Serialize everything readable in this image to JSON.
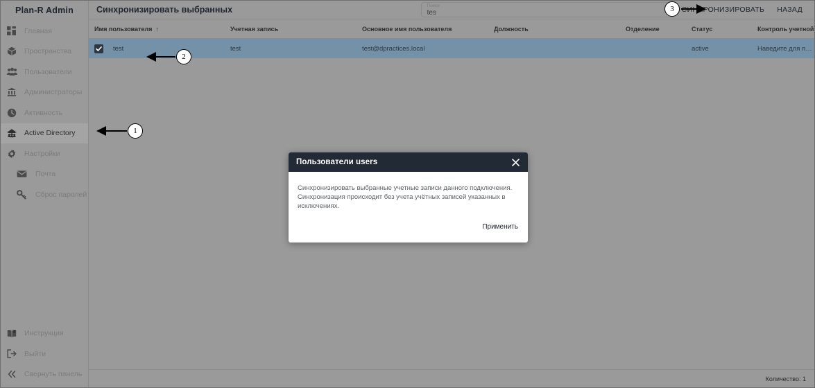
{
  "app": {
    "brand": "Plan-R Admin"
  },
  "sidebar": {
    "items": [
      {
        "label": "Главная",
        "icon": "dashboard-icon",
        "active": false,
        "indent": false
      },
      {
        "label": "Пространства",
        "icon": "cube-icon",
        "active": false,
        "indent": false
      },
      {
        "label": "Пользователи",
        "icon": "users-group-icon",
        "active": false,
        "indent": false
      },
      {
        "label": "Администраторы",
        "icon": "bank-icon",
        "active": false,
        "indent": false
      },
      {
        "label": "Активность",
        "icon": "clock-icon",
        "active": false,
        "indent": false
      },
      {
        "label": "Active Directory",
        "icon": "active-directory-icon",
        "active": true,
        "indent": false
      },
      {
        "label": "Настройки",
        "icon": "gear-icon",
        "active": false,
        "indent": false
      },
      {
        "label": "Почта",
        "icon": "mail-icon",
        "active": false,
        "indent": true
      },
      {
        "label": "Сброс паролей",
        "icon": "key-icon",
        "active": false,
        "indent": true
      }
    ],
    "bottom_items": [
      {
        "label": "Инструкция",
        "icon": "book-icon"
      },
      {
        "label": "Выйти",
        "icon": "logout-icon"
      },
      {
        "label": "Свернуть панель",
        "icon": "chevrons-left-icon"
      }
    ]
  },
  "header": {
    "title": "Синхронизировать выбранных",
    "search": {
      "label": "Поиск",
      "value": "tes",
      "placeholder": "Поиск"
    },
    "sync_button": "СИНХРОНИЗИРОВАТЬ",
    "back_button": "НАЗАД"
  },
  "table": {
    "columns": [
      {
        "key": "name",
        "label": "Имя пользователя",
        "sorted": true,
        "sort_arrow": "↑"
      },
      {
        "key": "acct",
        "label": "Учетная запись",
        "sorted": false,
        "sort_arrow": ""
      },
      {
        "key": "upn",
        "label": "Основное имя пользователя",
        "sorted": false,
        "sort_arrow": ""
      },
      {
        "key": "pos",
        "label": "Должность",
        "sorted": false,
        "sort_arrow": ""
      },
      {
        "key": "dept",
        "label": "Отделение",
        "sorted": false,
        "sort_arrow": ""
      },
      {
        "key": "status",
        "label": "Статус",
        "sorted": false,
        "sort_arrow": ""
      },
      {
        "key": "ctrl",
        "label": "Контроль учетной зап…",
        "sorted": false,
        "sort_arrow": ""
      }
    ],
    "rows": [
      {
        "selected": true,
        "checked": true,
        "name": "test",
        "acct": "test",
        "upn": "test@dpractices.local",
        "pos": "",
        "dept": "",
        "status": "active",
        "ctrl": "Наведите для просмотра"
      }
    ]
  },
  "footer": {
    "count": "Количество: 1"
  },
  "modal": {
    "title": "Пользователи users",
    "close_icon": "close-icon",
    "body": "Синхронизировать выбранные учетные записи данного подключения. Синхронизация происходит без учета учётных записей указанных в исключениях.",
    "apply_button": "Применить"
  },
  "annotations": [
    {
      "number": "1",
      "target": "sidebar-item-active-directory"
    },
    {
      "number": "2",
      "target": "table-row-checkbox"
    },
    {
      "number": "3",
      "target": "sync-button"
    }
  ],
  "colors": {
    "page_bg": "#9a9a9a",
    "selected_row": "#7591a8",
    "modal_header": "#222a35",
    "checkbox": "#2c3740",
    "text_dark": "#20262f",
    "text_muted": "#7c7c7c"
  }
}
